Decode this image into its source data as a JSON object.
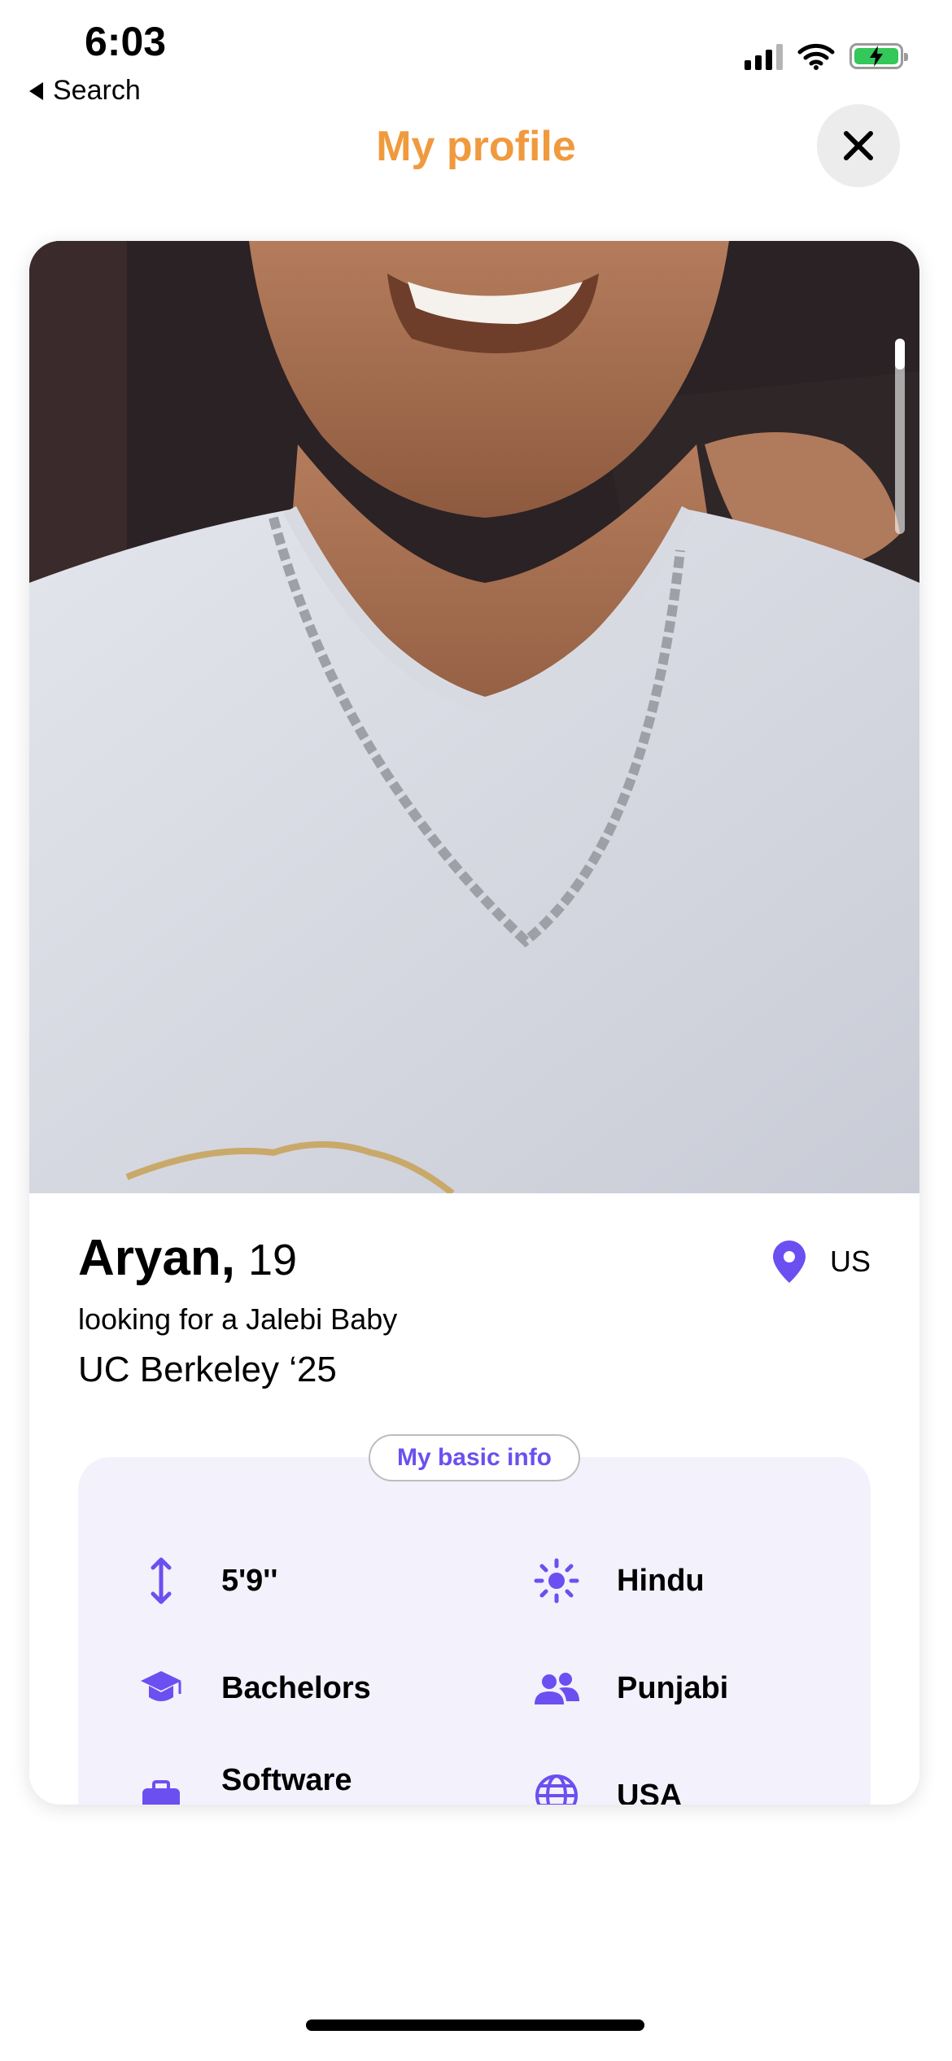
{
  "status_bar": {
    "time": "6:03",
    "back_label": "Search"
  },
  "header": {
    "title": "My profile",
    "title_color": "#f09a3e",
    "close_icon": "close-icon"
  },
  "profile": {
    "name": "Aryan,",
    "age": "19",
    "location": "US",
    "tagline": "looking for a Jalebi Baby",
    "school": "UC Berkeley ‘25"
  },
  "basic_info": {
    "label": "My basic info",
    "accent": "#6c4ff0",
    "items": [
      {
        "icon": "height-icon",
        "text": "5'9''"
      },
      {
        "icon": "sun-icon",
        "text": "Hindu"
      },
      {
        "icon": "graduation-cap-icon",
        "text": "Bachelors"
      },
      {
        "icon": "people-icon",
        "text": "Punjabi"
      },
      {
        "icon": "briefcase-icon",
        "text": "Software Engineer"
      },
      {
        "icon": "globe-icon",
        "text": "USA"
      }
    ]
  }
}
